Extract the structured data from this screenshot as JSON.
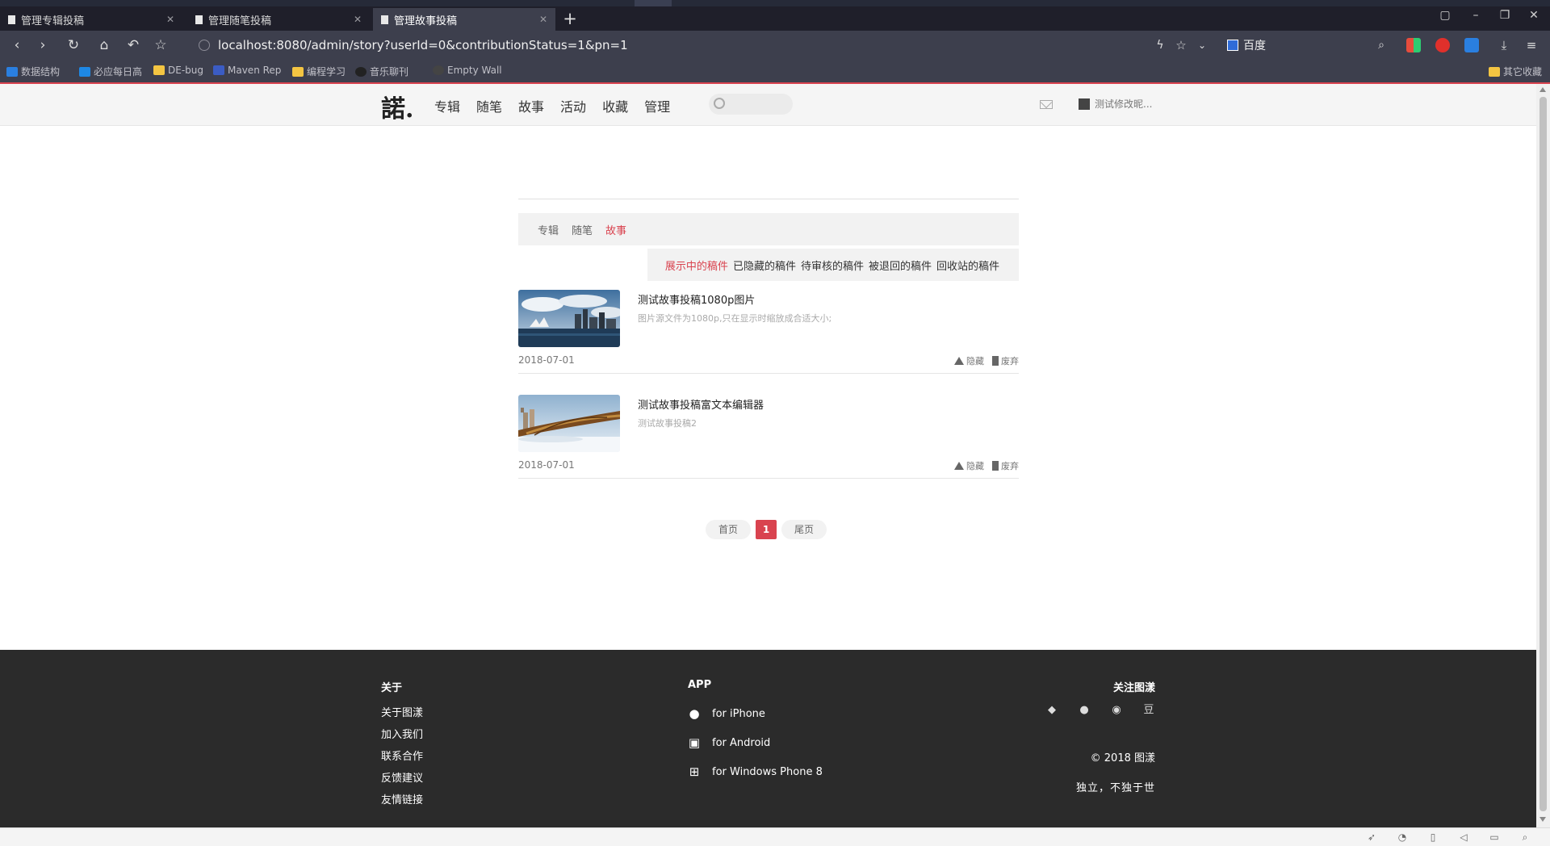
{
  "browser": {
    "tabs": [
      {
        "label": "管理专辑投稿",
        "active": false
      },
      {
        "label": "管理随笔投稿",
        "active": false
      },
      {
        "label": "管理故事投稿",
        "active": true
      }
    ],
    "url": "localhost:8080/admin/story?userId=0&contributionStatus=1&pn=1",
    "search_engine": "百度",
    "bookmarks": [
      "数据结构",
      "必应每日高",
      "DE-bug",
      "Maven Rep",
      "编程学习",
      "音乐聊刊",
      "Empty Wall"
    ],
    "bookmark_right": "其它收藏"
  },
  "site": {
    "logo": "諾.",
    "nav": [
      "专辑",
      "随笔",
      "故事",
      "活动",
      "收藏",
      "管理"
    ],
    "search_placeholder": "",
    "user_name": "测试修改昵..."
  },
  "content": {
    "categories": [
      {
        "label": "专辑",
        "active": false
      },
      {
        "label": "随笔",
        "active": false
      },
      {
        "label": "故事",
        "active": true
      }
    ],
    "statuses": [
      {
        "label": "展示中的稿件",
        "active": true
      },
      {
        "label": "已隐藏的稿件",
        "active": false
      },
      {
        "label": "待审核的稿件",
        "active": false
      },
      {
        "label": "被退回的稿件",
        "active": false
      },
      {
        "label": "回收站的稿件",
        "active": false
      }
    ],
    "posts": [
      {
        "title": "测试故事投稿1080p图片",
        "desc": "图片源文件为1080p,只在显示时缩放成合适大小;",
        "date": "2018-07-01",
        "hide_label": "隐藏",
        "discard_label": "废弃"
      },
      {
        "title": "测试故事投稿富文本编辑器",
        "desc": "测试故事投稿2",
        "date": "2018-07-01",
        "hide_label": "隐藏",
        "discard_label": "废弃"
      }
    ],
    "pager": {
      "first": "首页",
      "current": "1",
      "last": "尾页"
    }
  },
  "footer": {
    "about_head": "关于",
    "about_links": [
      "关于图漾",
      "加入我们",
      "联系合作",
      "反馈建议",
      "友情链接"
    ],
    "app_head": "APP",
    "apps": [
      "for iPhone",
      "for Android",
      "for Windows Phone 8"
    ],
    "follow_head": "关注图漾",
    "social_icons": [
      "qq-icon",
      "wechat-icon",
      "weibo-icon",
      "douban-icon"
    ],
    "douban_glyph": "豆",
    "copyright": "© 2018 图漾",
    "motto": "独立，不独于世"
  },
  "colors": {
    "accent": "#d9434f",
    "chrome_bg": "#3d3f4d",
    "footer_bg": "#2b2b2b"
  }
}
